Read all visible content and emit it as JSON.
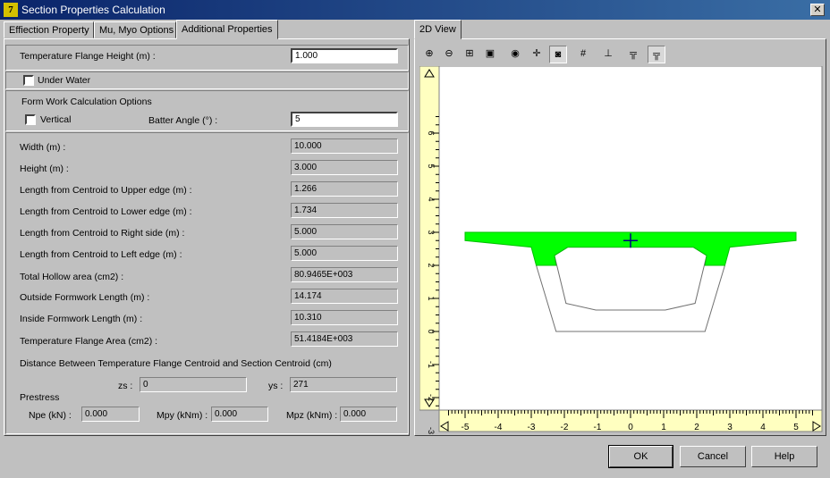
{
  "window": {
    "title": "Section Properties Calculation",
    "app_icon": "7"
  },
  "tabs": [
    {
      "label": "Effiection Property"
    },
    {
      "label": "Mu, Myo Options"
    },
    {
      "label": "Additional Properties"
    }
  ],
  "view_tab": {
    "label": "2D View"
  },
  "temperature_flange": {
    "label": "Temperature Flange Height (m) :",
    "value": "1.000"
  },
  "under_water": {
    "label": "Under Water",
    "checked": false
  },
  "formwork": {
    "title": "Form Work Calculation Options",
    "vertical_label": "Vertical",
    "batter_label": "Batter Angle (°) :",
    "batter_value": "5"
  },
  "properties": [
    {
      "label": "Width (m) :",
      "value": "10.000"
    },
    {
      "label": "Height (m) :",
      "value": "3.000"
    },
    {
      "label": "Length from Centroid to Upper edge (m) :",
      "value": "1.266"
    },
    {
      "label": "Length from Centroid to Lower edge (m) :",
      "value": "1.734"
    },
    {
      "label": "Length from Centroid to Right side (m) :",
      "value": "5.000"
    },
    {
      "label": "Length from Centroid to Left edge (m) :",
      "value": "5.000"
    },
    {
      "label": "Total Hollow area (cm2) :",
      "value": "80.9465E+003"
    },
    {
      "label": "Outside Formwork Length (m) :",
      "value": "14.174"
    },
    {
      "label": "Inside Formwork Length (m) :",
      "value": "10.310"
    },
    {
      "label": "Temperature Flange Area (cm2) :",
      "value": "51.4184E+003"
    }
  ],
  "distance": {
    "title": "Distance Between Temperature Flange Centroid and Section Centroid (cm)",
    "zs_label": "zs :",
    "zs_value": "0",
    "ys_label": "ys :",
    "ys_value": "271"
  },
  "prestress": {
    "title": "Prestress",
    "npe_label": "Npe (kN) :",
    "npe_value": "0.000",
    "mpy_label": "Mpy (kNm) :",
    "mpy_value": "0.000",
    "mpz_label": "Mpz (kNm) :",
    "mpz_value": "0.000"
  },
  "toolbar": [
    {
      "icon": "zoom-in-icon",
      "glyph": "⊕",
      "pressed": false
    },
    {
      "icon": "zoom-out-icon",
      "glyph": "⊖",
      "pressed": false
    },
    {
      "icon": "zoom-fit-icon",
      "glyph": "⊞",
      "pressed": false
    },
    {
      "icon": "zoom-window-icon",
      "glyph": "▣",
      "pressed": false
    },
    {
      "icon": "palette-icon",
      "glyph": "◉",
      "pressed": false
    },
    {
      "icon": "pan-icon",
      "glyph": "✛",
      "pressed": false
    },
    {
      "icon": "shade-icon",
      "glyph": "◙",
      "pressed": true
    },
    {
      "icon": "grid-icon",
      "glyph": "#",
      "pressed": false
    },
    {
      "icon": "dimension-icon",
      "glyph": "⊥",
      "pressed": false
    },
    {
      "icon": "section-outline-icon",
      "glyph": "╦",
      "pressed": false
    },
    {
      "icon": "section-flange-icon",
      "glyph": "╦",
      "pressed": true
    }
  ],
  "plot": {
    "x_ticks": [
      "-5",
      "-4",
      "-3",
      "-2",
      "-1",
      "0",
      "1",
      "2",
      "3",
      "4",
      "5"
    ],
    "y_ticks": [
      "6",
      "5",
      "4",
      "3",
      "2",
      "1",
      "0",
      "-1",
      "-2",
      "-3"
    ],
    "flange_color": "#00ff00",
    "centroid_color": "#000080"
  },
  "buttons": {
    "ok": "OK",
    "cancel": "Cancel",
    "help": "Help"
  }
}
